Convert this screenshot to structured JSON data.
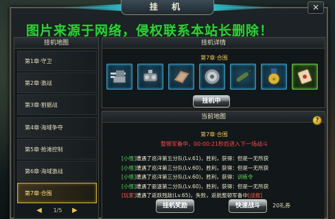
{
  "window": {
    "title": "挂 机",
    "close_label": "✕"
  },
  "watermark": "图片来源于网络，侵权联系本站长删除！",
  "left_panel": {
    "header": "挂机地图",
    "chapters": [
      {
        "label": "第1章·守卫"
      },
      {
        "label": "第2章·激战"
      },
      {
        "label": "第3章·割据战"
      },
      {
        "label": "第4章·海域争夺"
      },
      {
        "label": "第5章·抢滩控制"
      },
      {
        "label": "第6章·海域激战"
      },
      {
        "label": "第7章·合围"
      }
    ],
    "active_chapter": 6,
    "pager": {
      "current": "1/5"
    }
  },
  "detail_panel": {
    "header": "挂机详情",
    "chapter_title": "第7章·合围",
    "items": [
      {
        "icon": "turret-icon"
      },
      {
        "icon": "engine-icon"
      },
      {
        "icon": "armor-plate-icon"
      },
      {
        "icon": "radar-disc-icon"
      },
      {
        "icon": "torpedo-icon"
      },
      {
        "icon": "medal-icon"
      },
      {
        "icon": "scroll-icon"
      }
    ],
    "hangup_button": "挂机中"
  },
  "map_panel": {
    "header": "当前地图",
    "chapter_title": "第7章·合围",
    "countdown_prefix": "整顿军备中，",
    "countdown_time": "00:00:21",
    "countdown_suffix": "秒后进入下一场战斗",
    "log": [
      {
        "tag": "[小怪]",
        "text": "遭遇了巡洋第五分队(Lv.61)，胜利，获得：",
        "loot": "",
        "tail": "但是一无所获"
      },
      {
        "tag": "[小怪]",
        "text": "遭遇了巡洋第三分队(Lv.60)，胜利，获得：",
        "loot": "",
        "tail": "但是一无所获"
      },
      {
        "tag": "[小怪]",
        "text": "遭遇了巡洋第三分队(Lv.60)，胜利，获得：",
        "loot": "训练令",
        "tail": ""
      },
      {
        "tag": "[小怪]",
        "text": "遭遇了驱逐第二分队(Lv.60)，胜利，获得：",
        "loot": "",
        "tail": "但是一无所获"
      },
      {
        "tag": "[玩家]",
        "text": "遭遇了返跃残敌(Lv.65)，失败，返航整顿军备中",
        "loot": "",
        "tail": "[战报]"
      }
    ],
    "reward_button": "挂机奖励",
    "fast_battle_button": "快速战斗",
    "coupon": "20礼券"
  },
  "colors": {
    "accent_gold": "#ebc85a",
    "loot_green": "#5de05a",
    "alert_red": "#ff4a4a",
    "watermark_green": "#2fd03a"
  }
}
